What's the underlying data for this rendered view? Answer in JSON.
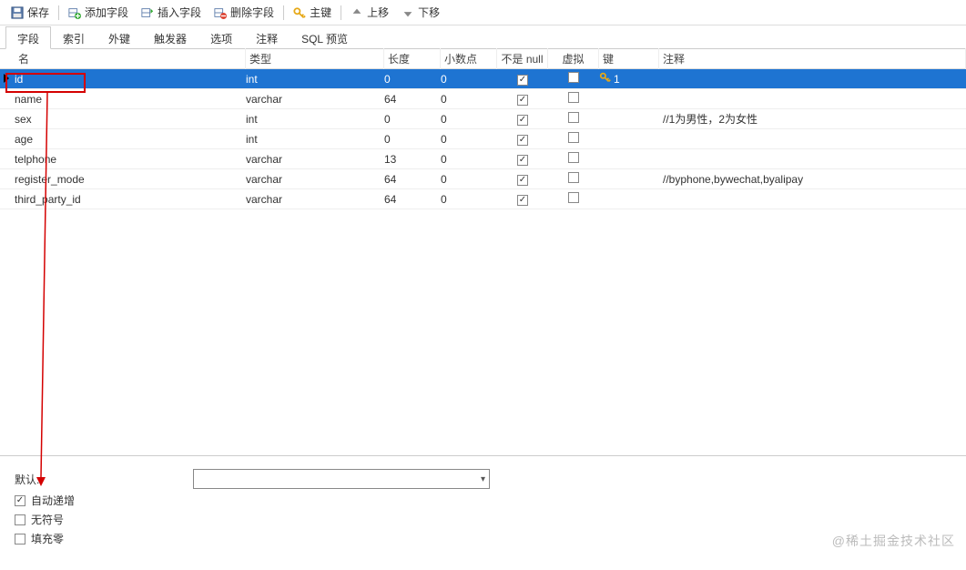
{
  "toolbar": {
    "save": "保存",
    "add_field": "添加字段",
    "insert_field": "插入字段",
    "delete_field": "删除字段",
    "primary_key": "主键",
    "move_up": "上移",
    "move_down": "下移"
  },
  "tabs": {
    "items": [
      {
        "label": "字段",
        "active": true
      },
      {
        "label": "索引",
        "active": false
      },
      {
        "label": "外键",
        "active": false
      },
      {
        "label": "触发器",
        "active": false
      },
      {
        "label": "选项",
        "active": false
      },
      {
        "label": "注释",
        "active": false
      },
      {
        "label": "SQL 预览",
        "active": false
      }
    ]
  },
  "grid": {
    "headers": {
      "name": "名",
      "type": "类型",
      "length": "长度",
      "decimal": "小数点",
      "not_null": "不是 null",
      "virtual": "虚拟",
      "key": "键",
      "comment": "注释"
    },
    "rows": [
      {
        "name": "id",
        "type": "int",
        "length": "0",
        "decimal": "0",
        "not_null": true,
        "virtual": false,
        "key": "1",
        "comment": "",
        "selected": true
      },
      {
        "name": "name",
        "type": "varchar",
        "length": "64",
        "decimal": "0",
        "not_null": true,
        "virtual": false,
        "key": "",
        "comment": "",
        "selected": false
      },
      {
        "name": "sex",
        "type": "int",
        "length": "0",
        "decimal": "0",
        "not_null": true,
        "virtual": false,
        "key": "",
        "comment": "//1为男性，2为女性",
        "selected": false
      },
      {
        "name": "age",
        "type": "int",
        "length": "0",
        "decimal": "0",
        "not_null": true,
        "virtual": false,
        "key": "",
        "comment": "",
        "selected": false
      },
      {
        "name": "telphone",
        "type": "varchar",
        "length": "13",
        "decimal": "0",
        "not_null": true,
        "virtual": false,
        "key": "",
        "comment": "",
        "selected": false
      },
      {
        "name": "register_mode",
        "type": "varchar",
        "length": "64",
        "decimal": "0",
        "not_null": true,
        "virtual": false,
        "key": "",
        "comment": "//byphone,bywechat,byalipay",
        "selected": false
      },
      {
        "name": "third_party_id",
        "type": "varchar",
        "length": "64",
        "decimal": "0",
        "not_null": true,
        "virtual": false,
        "key": "",
        "comment": "",
        "selected": false
      }
    ]
  },
  "properties": {
    "default_label": "默认:",
    "default_value": "",
    "auto_increment": {
      "label": "自动递增",
      "checked": true
    },
    "unsigned": {
      "label": "无符号",
      "checked": false
    },
    "zerofill": {
      "label": "填充零",
      "checked": false
    }
  },
  "watermark": "@稀土掘金技术社区"
}
